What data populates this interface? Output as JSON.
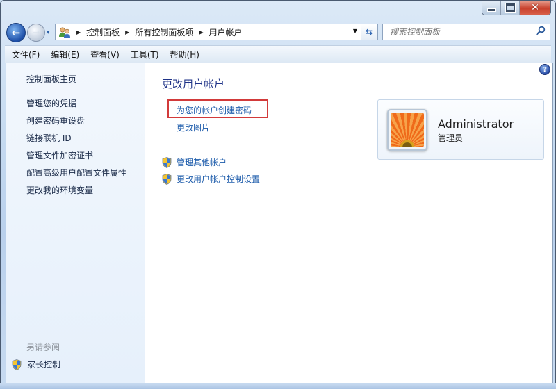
{
  "window": {
    "caption_buttons": {
      "minimize": "minimize-icon",
      "maximize": "maximize-icon",
      "close": "close-icon",
      "close_glyph": "✕"
    }
  },
  "navigation": {
    "back_glyph": "←",
    "forward_glyph": "→",
    "history_glyph": "▾",
    "breadcrumb": [
      "控制面板",
      "所有控制面板项",
      "用户帐户"
    ],
    "crumb_separator": "▶",
    "address_dropdown_glyph": "▼",
    "refresh_glyph": "⇆",
    "search_placeholder": "搜索控制面板",
    "search_glyph": "⚲"
  },
  "menubar": {
    "items": [
      "文件(F)",
      "编辑(E)",
      "查看(V)",
      "工具(T)",
      "帮助(H)"
    ]
  },
  "sidebar": {
    "home": "控制面板主页",
    "links": [
      "管理您的凭据",
      "创建密码重设盘",
      "链接联机 ID",
      "管理文件加密证书",
      "配置高级用户配置文件属性",
      "更改我的环境变量"
    ],
    "see_also_label": "另请参阅",
    "see_also_links": [
      "家长控制"
    ]
  },
  "main": {
    "help_glyph": "?",
    "title": "更改用户帐户",
    "tasks": [
      "为您的帐户创建密码",
      "更改图片"
    ],
    "highlighted_task": "为您的帐户创建密码",
    "admin_tasks": [
      "管理其他帐户",
      "更改用户帐户控制设置"
    ],
    "highlight_color": "#d23a3a",
    "link_color": "#1e5cab"
  },
  "user": {
    "name": "Administrator",
    "role": "管理员"
  }
}
